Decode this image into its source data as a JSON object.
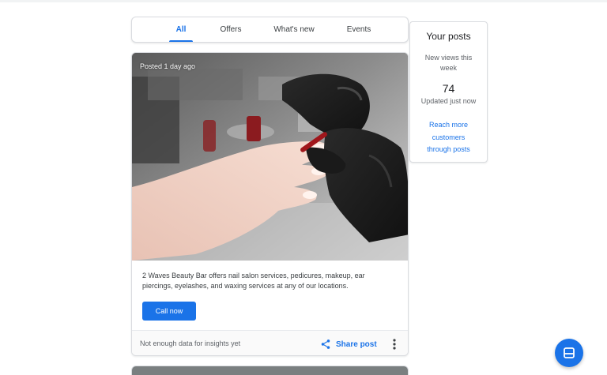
{
  "tabs": {
    "items": [
      {
        "label": "All",
        "active": true
      },
      {
        "label": "Offers",
        "active": false
      },
      {
        "label": "What's new",
        "active": false
      },
      {
        "label": "Events",
        "active": false
      }
    ]
  },
  "post": {
    "posted_time": "Posted 1 day ago",
    "image_icon": "nail-salon-photo",
    "text": "2 Waves Beauty Bar offers nail salon services, pedicures, makeup, ear piercings, eyelashes, and waxing services at any of our locations.",
    "call_label": "Call now",
    "footer": {
      "insights_text": "Not enough data for insights yet",
      "share_label": "Share post",
      "share_icon": "share-icon",
      "more_icon": "more-vert-icon"
    }
  },
  "side": {
    "title": "Your posts",
    "views_label": "New views this week",
    "views_count": "74",
    "updated": "Updated just now",
    "link": "Reach more customers through posts"
  },
  "fab": {
    "icon": "message-icon"
  },
  "colors": {
    "accent": "#1a73e8",
    "text": "#3c4043",
    "border": "#dadce0"
  }
}
